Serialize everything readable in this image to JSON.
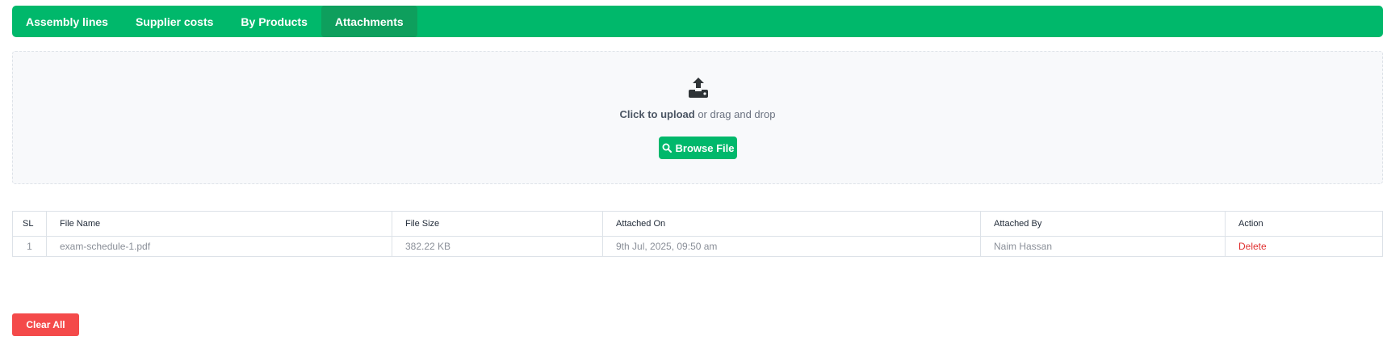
{
  "tabs": [
    {
      "label": "Assembly lines",
      "active": false
    },
    {
      "label": "Supplier costs",
      "active": false
    },
    {
      "label": "By Products",
      "active": false
    },
    {
      "label": "Attachments",
      "active": true
    }
  ],
  "upload": {
    "click_text": "Click to upload",
    "rest_text": " or drag and drop",
    "browse_label": "Browse File",
    "icon": "upload-icon"
  },
  "table": {
    "headers": [
      "SL",
      "File Name",
      "File Size",
      "Attached On",
      "Attached By",
      "Action"
    ],
    "rows": [
      {
        "sl": "1",
        "file_name": "exam-schedule-1.pdf",
        "file_size": "382.22 KB",
        "attached_on": "9th Jul, 2025, 09:50 am",
        "attached_by": "Naim Hassan",
        "action": "Delete"
      }
    ]
  },
  "clear_label": "Clear All",
  "colors": {
    "accent": "#00b86b",
    "danger": "#f44a4a",
    "delete_text": "#e03131"
  }
}
